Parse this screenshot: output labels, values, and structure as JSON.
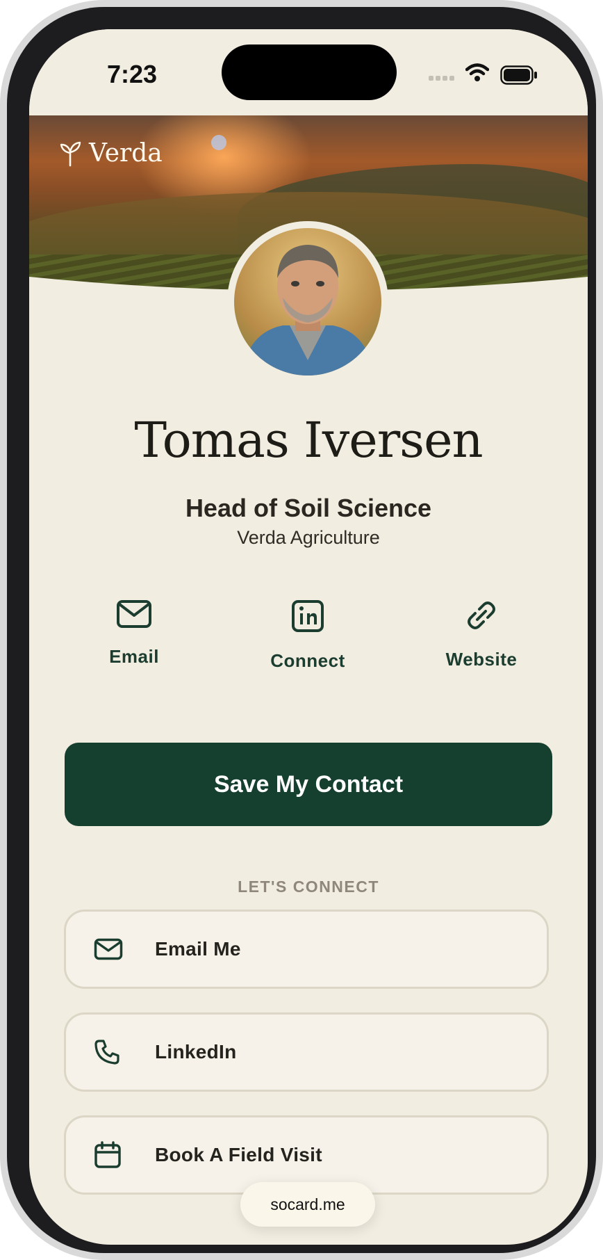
{
  "status_bar": {
    "time": "7:23"
  },
  "brand": {
    "name": "Verda"
  },
  "profile": {
    "name": "Tomas Iversen",
    "title": "Head of Soil Science",
    "company": "Verda Agriculture"
  },
  "quick_actions": [
    {
      "label": "Email",
      "icon": "envelope-icon"
    },
    {
      "label": "Connect",
      "icon": "linkedin-icon"
    },
    {
      "label": "Website",
      "icon": "link-icon"
    }
  ],
  "save_button": {
    "label": "Save My Contact"
  },
  "connect_section": {
    "heading": "LET'S CONNECT",
    "links": [
      {
        "label": "Email Me",
        "icon": "envelope-icon"
      },
      {
        "label": "LinkedIn",
        "icon": "phone-icon"
      },
      {
        "label": "Book A Field Visit",
        "icon": "calendar-icon"
      }
    ]
  },
  "footer": {
    "url": "socard.me"
  },
  "colors": {
    "accent": "#153f2f",
    "background": "#f2ede1",
    "card": "#f6f2e9",
    "muted": "#8f877b"
  }
}
